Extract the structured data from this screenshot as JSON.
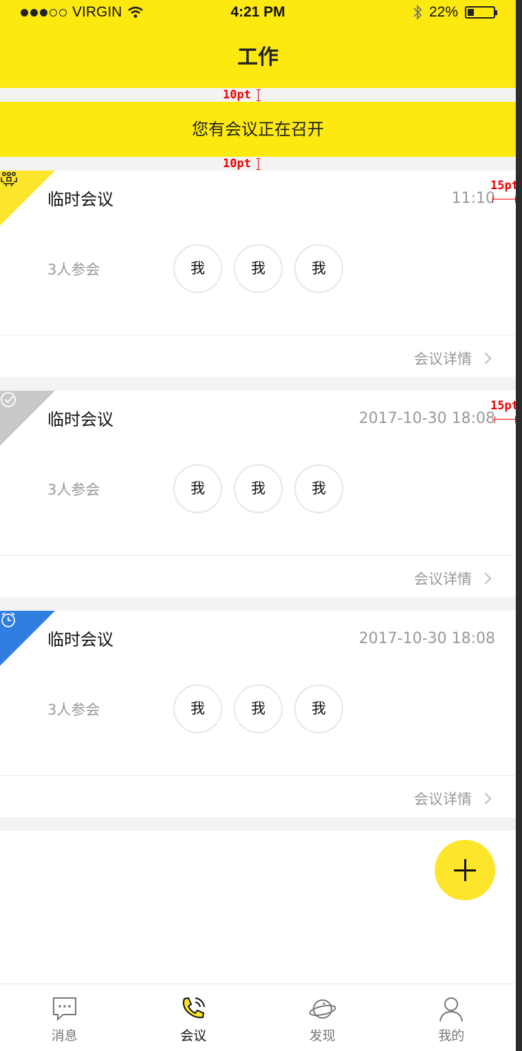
{
  "status_bar": {
    "carrier": "VIRGIN",
    "time": "4:21 PM",
    "battery": "22%"
  },
  "header": {
    "title": "工作"
  },
  "banner": {
    "text": "您有会议正在召开"
  },
  "annotations": {
    "gap_top": "10pt",
    "gap_bottom": "10pt",
    "margin_right_1": "15pt",
    "margin_right_2": "15pt"
  },
  "meetings": [
    {
      "status": "ongoing",
      "status_icon": "meeting-people-icon",
      "status_color": "#fde52b",
      "title": "临时会议",
      "time": "11:10",
      "count": "3人参会",
      "attendees": [
        "我",
        "我",
        "我"
      ],
      "detail_label": "会议详情"
    },
    {
      "status": "finished",
      "status_icon": "check-circle-icon",
      "status_color": "#c8c8c8",
      "title": "临时会议",
      "time": "2017-10-30 18:08",
      "count": "3人参会",
      "attendees": [
        "我",
        "我",
        "我"
      ],
      "detail_label": "会议详情"
    },
    {
      "status": "scheduled",
      "status_icon": "alarm-clock-icon",
      "status_color": "#2f7ee0",
      "title": "临时会议",
      "time": "2017-10-30 18:08",
      "count": "3人参会",
      "attendees": [
        "我",
        "我",
        "我"
      ],
      "detail_label": "会议详情"
    }
  ],
  "fab": {
    "icon": "plus-icon"
  },
  "tabs": [
    {
      "label": "消息",
      "icon": "chat-bubble-icon",
      "active": false
    },
    {
      "label": "会议",
      "icon": "phone-call-icon",
      "active": true
    },
    {
      "label": "发现",
      "icon": "planet-icon",
      "active": false
    },
    {
      "label": "我的",
      "icon": "person-icon",
      "active": false
    }
  ],
  "colors": {
    "brand_yellow": "#fde910",
    "background_gray": "#f3f3f3",
    "text_gray": "#999999"
  }
}
